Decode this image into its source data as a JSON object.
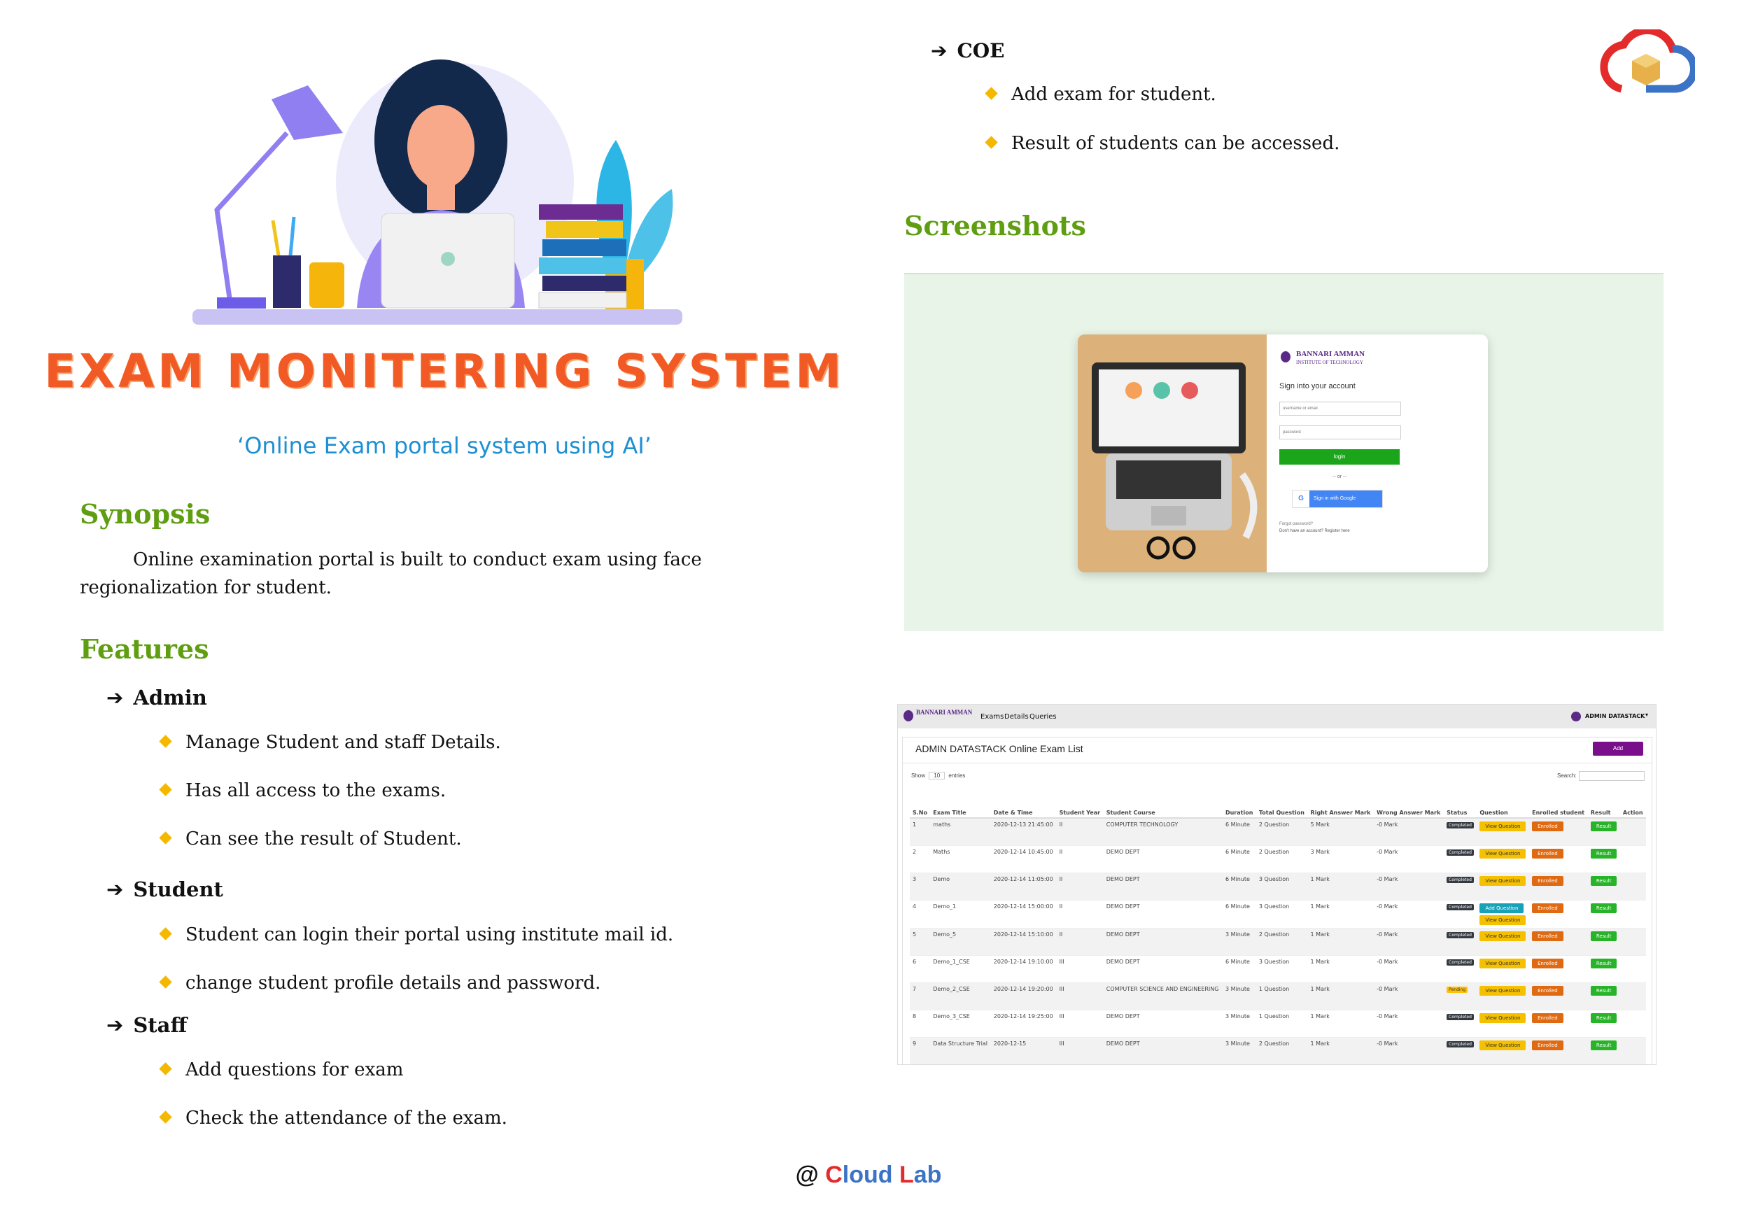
{
  "title": "EXAM MONITERING SYSTEM",
  "subtitle": "‘Online Exam portal system using AI’",
  "synopsis": {
    "heading": "Synopsis",
    "text": "Online examination portal is built to conduct exam using face regionalization for student."
  },
  "features": {
    "heading": "Features",
    "groups": [
      {
        "role": "Admin",
        "items": [
          "Manage Student and staff Details.",
          "Has all access to the exams.",
          "Can see the result of Student."
        ]
      },
      {
        "role": "Student",
        "items": [
          "Student can login their portal using institute mail id.",
          "change student profile details and password."
        ]
      },
      {
        "role": "Staff",
        "items": [
          "Add questions for exam",
          "Check the attendance of the exam."
        ]
      },
      {
        "role": "COE",
        "items": [
          "Add exam for student.",
          "Result of students can be accessed."
        ]
      }
    ]
  },
  "screenshots": {
    "heading": "Screenshots",
    "login": {
      "institute": "BANNARI AMMAN",
      "institute_sub": "INSTITUTE OF TECHNOLOGY",
      "prompt": "Sign into your account",
      "username_placeholder": "username or email",
      "password_placeholder": "password",
      "login_button": "login",
      "or": "-- or --",
      "google_button": "Sign in with Google",
      "forgot": "Forgot password?",
      "register": "Don't have an account? Register here"
    },
    "exam_list": {
      "nav": [
        "Exams",
        "Details",
        "Queries"
      ],
      "user": "ADMIN DATASTACK",
      "heading": "ADMIN DATASTACK Online Exam List",
      "add_button": "Add",
      "show": "Show",
      "show_value": "10",
      "entries": "entries",
      "search": "Search:",
      "columns": [
        "S.No",
        "Exam Title",
        "Date & Time",
        "Student Year",
        "Student Course",
        "Duration",
        "Total Question",
        "Right Answer Mark",
        "Wrong Answer Mark",
        "Status",
        "Question",
        "Enrolled student",
        "Result",
        "Action"
      ],
      "rows": [
        {
          "sno": "1",
          "title": "maths",
          "date": "2020-12-13 21:45:00",
          "year": "II",
          "course": "COMPUTER TECHNOLOGY",
          "duration": "6 Minute",
          "total": "2 Question",
          "right": "5 Mark",
          "wrong": "-0 Mark",
          "status": "Completed",
          "question": "View Question",
          "enrolled": "Enrolled",
          "result": "Result"
        },
        {
          "sno": "2",
          "title": "Maths",
          "date": "2020-12-14 10:45:00",
          "year": "II",
          "course": "DEMO DEPT",
          "duration": "6 Minute",
          "total": "2 Question",
          "right": "3 Mark",
          "wrong": "-0 Mark",
          "status": "Completed",
          "question": "View Question",
          "enrolled": "Enrolled",
          "result": "Result"
        },
        {
          "sno": "3",
          "title": "Demo",
          "date": "2020-12-14 11:05:00",
          "year": "II",
          "course": "DEMO DEPT",
          "duration": "6 Minute",
          "total": "3 Question",
          "right": "1 Mark",
          "wrong": "-0 Mark",
          "status": "Completed",
          "question": "View Question",
          "enrolled": "Enrolled",
          "result": "Result"
        },
        {
          "sno": "4",
          "title": "Demo_1",
          "date": "2020-12-14 15:00:00",
          "year": "II",
          "course": "DEMO DEPT",
          "duration": "6 Minute",
          "total": "3 Question",
          "right": "1 Mark",
          "wrong": "-0 Mark",
          "status": "Completed",
          "question": "Add Question",
          "question2": "View Question",
          "enrolled": "Enrolled",
          "result": "Result"
        },
        {
          "sno": "5",
          "title": "Demo_5",
          "date": "2020-12-14 15:10:00",
          "year": "II",
          "course": "DEMO DEPT",
          "duration": "3 Minute",
          "total": "2 Question",
          "right": "1 Mark",
          "wrong": "-0 Mark",
          "status": "Completed",
          "question": "View Question",
          "enrolled": "Enrolled",
          "result": "Result"
        },
        {
          "sno": "6",
          "title": "Demo_1_CSE",
          "date": "2020-12-14 19:10:00",
          "year": "III",
          "course": "DEMO DEPT",
          "duration": "6 Minute",
          "total": "3 Question",
          "right": "1 Mark",
          "wrong": "-0 Mark",
          "status": "Completed",
          "question": "View Question",
          "enrolled": "Enrolled",
          "result": "Result"
        },
        {
          "sno": "7",
          "title": "Demo_2_CSE",
          "date": "2020-12-14 19:20:00",
          "year": "III",
          "course": "COMPUTER SCIENCE AND ENGINEERING",
          "duration": "3 Minute",
          "total": "1 Question",
          "right": "1 Mark",
          "wrong": "-0 Mark",
          "status": "Pending",
          "question": "View Question",
          "enrolled": "Enrolled",
          "result": "Result"
        },
        {
          "sno": "8",
          "title": "Demo_3_CSE",
          "date": "2020-12-14 19:25:00",
          "year": "III",
          "course": "DEMO DEPT",
          "duration": "3 Minute",
          "total": "1 Question",
          "right": "1 Mark",
          "wrong": "-0 Mark",
          "status": "Completed",
          "question": "View Question",
          "enrolled": "Enrolled",
          "result": "Result"
        },
        {
          "sno": "9",
          "title": "Data Structure Trial",
          "date": "2020-12-15",
          "year": "III",
          "course": "DEMO DEPT",
          "duration": "3 Minute",
          "total": "2 Question",
          "right": "1 Mark",
          "wrong": "-0 Mark",
          "status": "Completed",
          "question": "View Question",
          "enrolled": "Enrolled",
          "result": "Result"
        }
      ]
    }
  },
  "footer": {
    "at": "@ ",
    "c": "C",
    "loud": "loud ",
    "l": "L",
    "ab": "ab"
  },
  "colors": {
    "title": "#f15a24",
    "subtitle": "#1d8fd3",
    "heading": "#5e9e10",
    "bullet": "#f4b800",
    "brand_red": "#e32b2b",
    "brand_blue": "#3b73c6"
  },
  "icons": [
    "cloud-logo-icon",
    "arrow-right-icon",
    "diamond-bullet-icon",
    "google-icon"
  ]
}
